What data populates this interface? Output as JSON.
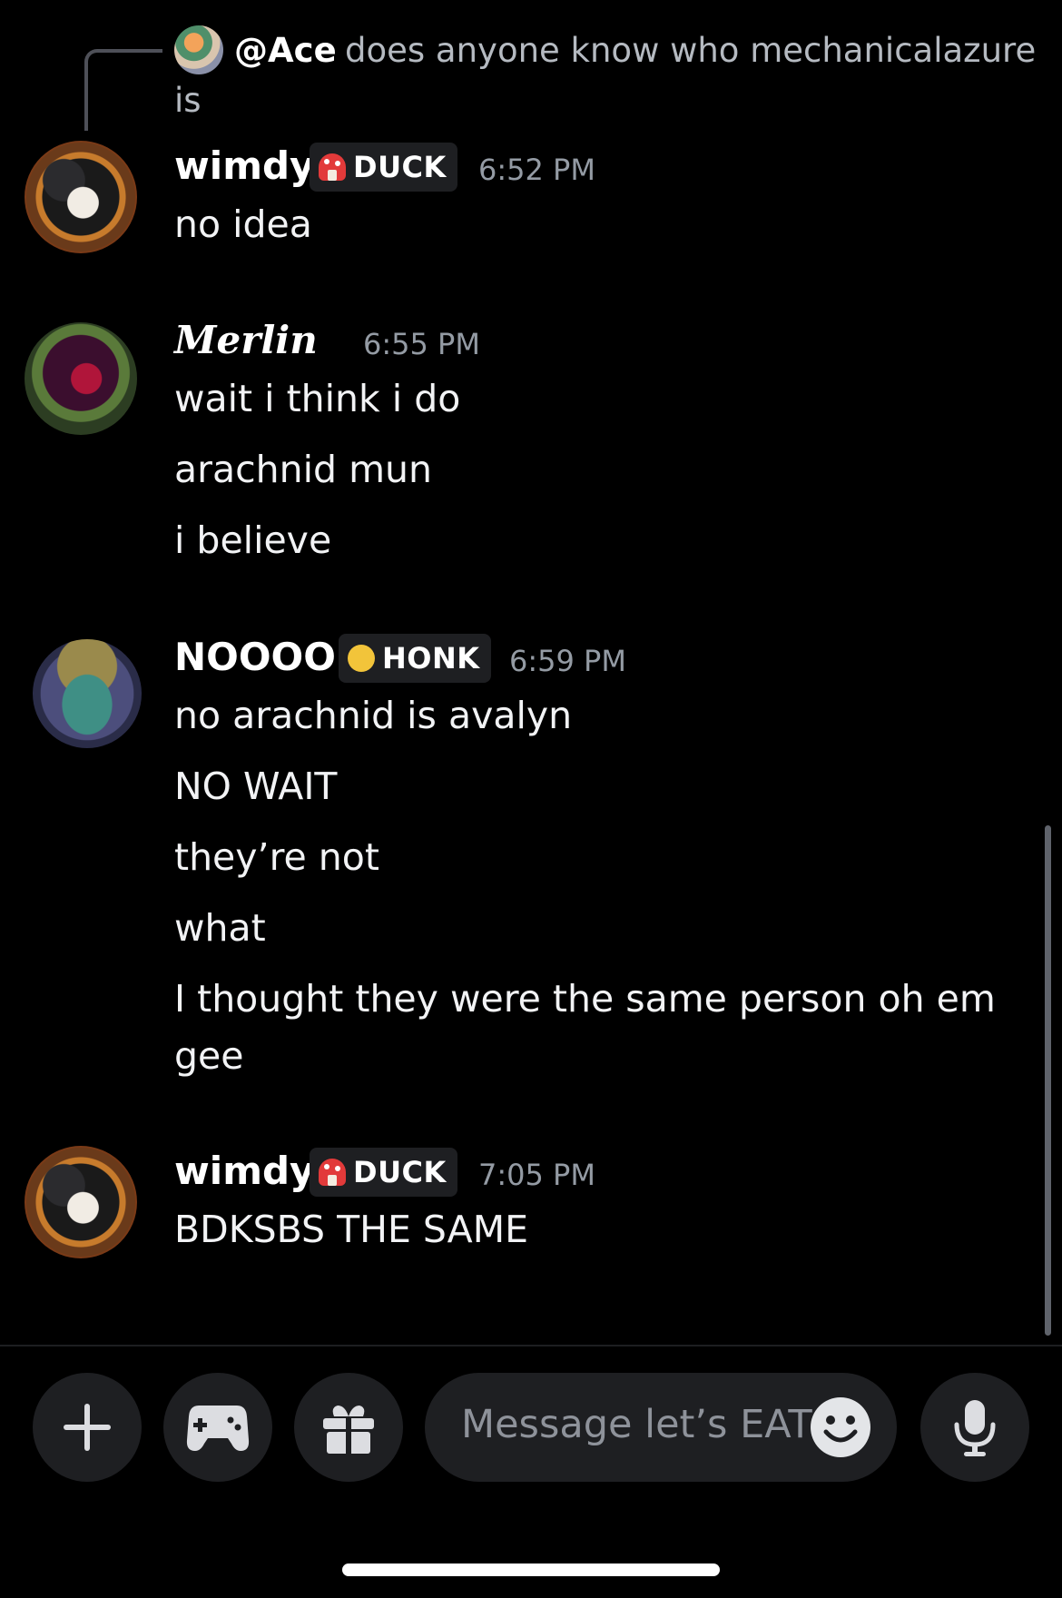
{
  "reply": {
    "author": "@Ace",
    "text": "does anyone know who mechanicalazure",
    "text_wrap": "is"
  },
  "messages": [
    {
      "author": "wimdy",
      "tag": "DUCK",
      "tag_icon": "mushroom-icon",
      "time": "6:52 PM",
      "lines": [
        "no idea"
      ]
    },
    {
      "author": "Merlin",
      "time": "6:55 PM",
      "lines": [
        "wait i think i do",
        "arachnid mun",
        "i believe"
      ]
    },
    {
      "author": "NOOOO",
      "tag": "HONK",
      "tag_icon": "heart-icon",
      "time": "6:59 PM",
      "lines": [
        "no arachnid is avalyn",
        "NO WAIT",
        "they’re not",
        "what",
        "I thought they were the same person oh em",
        "gee"
      ]
    },
    {
      "author": "wimdy",
      "tag": "DUCK",
      "tag_icon": "mushroom-icon",
      "time": "7:05 PM",
      "lines": [
        "BDKSBS THE SAME"
      ]
    }
  ],
  "composer": {
    "placeholder": "Message let’s EAT",
    "buttons": [
      "plus-icon",
      "gamepad-icon",
      "gift-icon",
      "emoji-icon",
      "microphone-icon"
    ]
  },
  "colors": {
    "background": "#000000",
    "secondary_text": "#949ba4",
    "tag_background": "#1e1f22"
  }
}
